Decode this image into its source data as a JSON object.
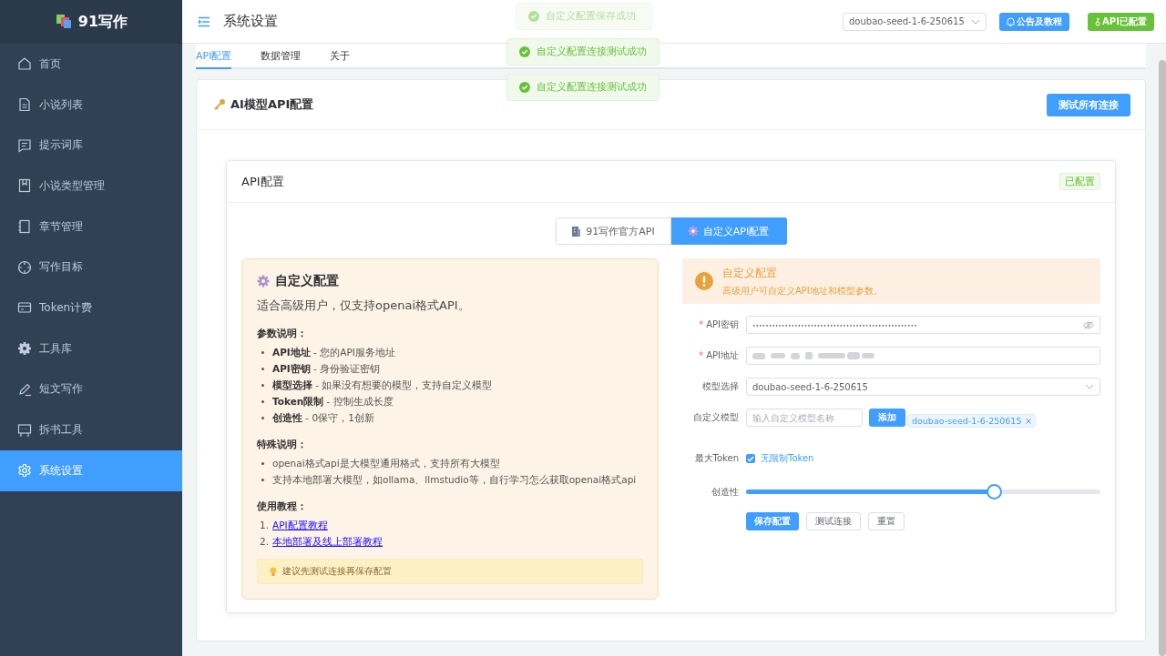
{
  "app": {
    "name": "91写作"
  },
  "sidebar": {
    "items": [
      {
        "label": "首页",
        "selected": false
      },
      {
        "label": "小说列表",
        "selected": false
      },
      {
        "label": "提示词库",
        "selected": false
      },
      {
        "label": "小说类型管理",
        "selected": false
      },
      {
        "label": "章节管理",
        "selected": false
      },
      {
        "label": "写作目标",
        "selected": false
      },
      {
        "label": "Token计费",
        "selected": false
      },
      {
        "label": "工具库",
        "selected": false
      },
      {
        "label": "短文写作",
        "selected": false
      },
      {
        "label": "拆书工具",
        "selected": false
      },
      {
        "label": "系统设置",
        "selected": true
      }
    ]
  },
  "header": {
    "title": "系统设置",
    "model_select": "doubao-seed-1-6-250615",
    "notice_button": "公告及教程",
    "api_button": "API已配置"
  },
  "toasts": [
    {
      "text": "自定义配置保存成功",
      "faded": true
    },
    {
      "text": "自定义配置连接测试成功",
      "faded": false
    },
    {
      "text": "自定义配置连接测试成功",
      "faded": false
    }
  ],
  "tabs": [
    {
      "label": "API配置",
      "selected": true
    },
    {
      "label": "数据管理",
      "selected": false
    },
    {
      "label": "关于",
      "selected": false
    }
  ],
  "panel": {
    "title": "AI模型API配置",
    "test_all_button": "测试所有连接"
  },
  "api_card": {
    "title": "API配置",
    "status_tag": "已配置",
    "modes": [
      {
        "label": "91写作官方API",
        "selected": false
      },
      {
        "label": "自定义API配置",
        "selected": true
      }
    ]
  },
  "info": {
    "title": "自定义配置",
    "subtitle": "适合高级用户，仅支持openai格式API。",
    "sections": [
      {
        "heading": "参数说明：",
        "kind": "bullets",
        "items": [
          "**API地址** - 您的API服务地址",
          "**API密钥** - 身份验证密钥",
          "**模型选择** - 如果没有想要的模型，支持自定义模型",
          "**Token限制** - 控制生成长度",
          "**创造性** - 0保守，1创新"
        ]
      },
      {
        "heading": "特殊说明：",
        "kind": "bullets",
        "items": [
          "openai格式api是大模型通用格式，支持所有大模型",
          "支持本地部署大模型，如ollama、llmstudio等，自行学习怎么获取openai格式api"
        ]
      },
      {
        "heading": "使用教程：",
        "kind": "links",
        "items": [
          {
            "number": "1.",
            "label": "API配置教程"
          },
          {
            "number": "2.",
            "label": "本地部署及线上部署教程"
          }
        ]
      }
    ],
    "tip": "建议先测试连接再保存配置"
  },
  "alert": {
    "title": "自定义配置",
    "description": "高级用户可自定义API地址和模型参数。"
  },
  "form": {
    "api_key": {
      "label": "API密钥",
      "required_mark": "*",
      "value": "•••••••••••••••••••••••••••••••••••••••••••••••••••"
    },
    "api_url": {
      "label": "API地址",
      "required_mark": "*"
    },
    "model": {
      "label": "模型选择",
      "value": "doubao-seed-1-6-250615"
    },
    "custom_model": {
      "label": "自定义模型",
      "placeholder": "输入自定义模型名称",
      "add_button": "添加",
      "tags": [
        "doubao-seed-1-6-250615"
      ]
    },
    "max_token": {
      "label": "最大Token",
      "checkbox_label": "无限制Token",
      "checked": true
    },
    "creativity": {
      "label": "创造性",
      "level": 0.7
    },
    "buttons": [
      {
        "label": "保存配置",
        "kind": "primary"
      },
      {
        "label": "测试连接",
        "kind": "plain"
      },
      {
        "label": "重置",
        "kind": "plain"
      }
    ]
  }
}
